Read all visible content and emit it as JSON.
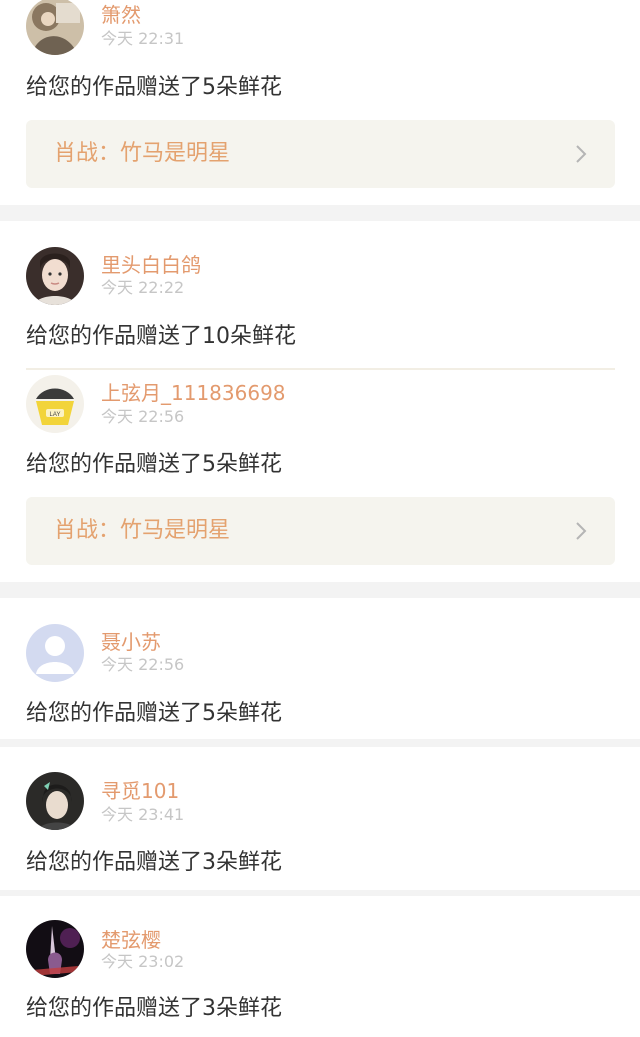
{
  "feed": {
    "items": [
      {
        "name": "箫然",
        "time": "今天 22:31",
        "message": "给您的作品赠送了5朵鲜花",
        "work": "肖战：竹马是明星"
      },
      {
        "name": "里头白白鸽",
        "time": "今天 22:22",
        "message": "给您的作品赠送了10朵鲜花"
      },
      {
        "name": "上弦月_111836698",
        "time": "今天 22:56",
        "message": "给您的作品赠送了5朵鲜花",
        "work": "肖战：竹马是明星",
        "avatar_badge": "LAY"
      },
      {
        "name": "聂小苏",
        "time": "今天 22:56",
        "message": "给您的作品赠送了5朵鲜花"
      },
      {
        "name": "寻觅101",
        "time": "今天 23:41",
        "message": "给您的作品赠送了3朵鲜花"
      },
      {
        "name": "楚弦樱",
        "time": "今天 23:02",
        "message": "给您的作品赠送了3朵鲜花"
      }
    ]
  },
  "colors": {
    "name": "#e39a6e",
    "time": "#c6c6c6",
    "message": "#333333",
    "card_bg": "#f5f4ee",
    "divider": "#f3f3f3"
  },
  "icons": {
    "chevron": "chevron-right-icon",
    "default_avatar": "default-avatar-icon"
  }
}
